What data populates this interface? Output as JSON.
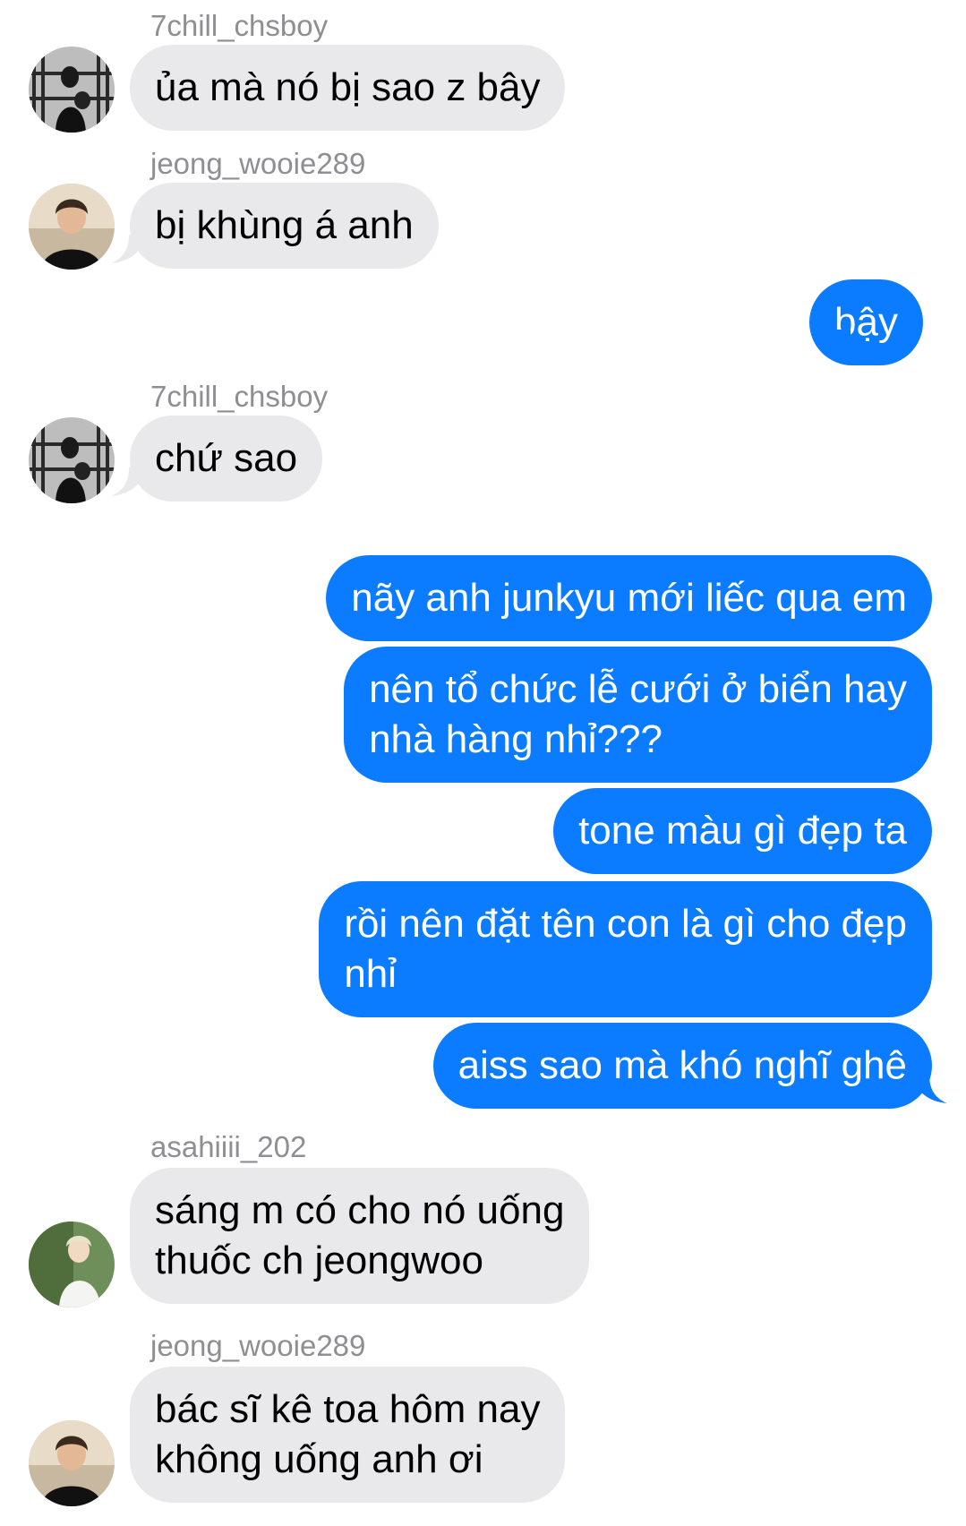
{
  "colors": {
    "incoming_bubble": "#e9e9eb",
    "outgoing_bubble": "#0b7cff",
    "sender_name": "#8e8e93"
  },
  "messages": [
    {
      "sender": "7chill_chsboy",
      "avatar": "avatar-7chill",
      "lines": [
        "ủa mà nó bị sao z bây"
      ]
    },
    {
      "sender": "jeong_wooie289",
      "avatar": "avatar-jeongwoo",
      "lines": [
        "bị khùng á anh"
      ]
    },
    {
      "lines": [
        "bậy"
      ]
    },
    {
      "sender": "7chill_chsboy",
      "avatar": "avatar-7chill",
      "lines": [
        "chứ sao"
      ]
    },
    {
      "lines": [
        "nãy anh junkyu mới liếc qua em"
      ]
    },
    {
      "lines": [
        "nên tổ chức lễ cưới ở biển hay",
        "nhà hàng nhỉ???"
      ]
    },
    {
      "lines": [
        "tone màu gì đẹp ta"
      ]
    },
    {
      "lines": [
        "rồi nên đặt tên con là gì cho đẹp",
        "nhỉ"
      ]
    },
    {
      "lines": [
        "aiss sao mà khó nghĩ ghê"
      ]
    },
    {
      "sender": "asahiiii_202",
      "avatar": "avatar-asahi",
      "lines": [
        "sáng m có cho nó uống",
        "thuốc ch jeongwoo"
      ]
    },
    {
      "sender": "jeong_wooie289",
      "avatar": "avatar-jeongwoo",
      "lines": [
        "bác sĩ kê toa hôm nay",
        "không uống anh ơi"
      ]
    }
  ]
}
